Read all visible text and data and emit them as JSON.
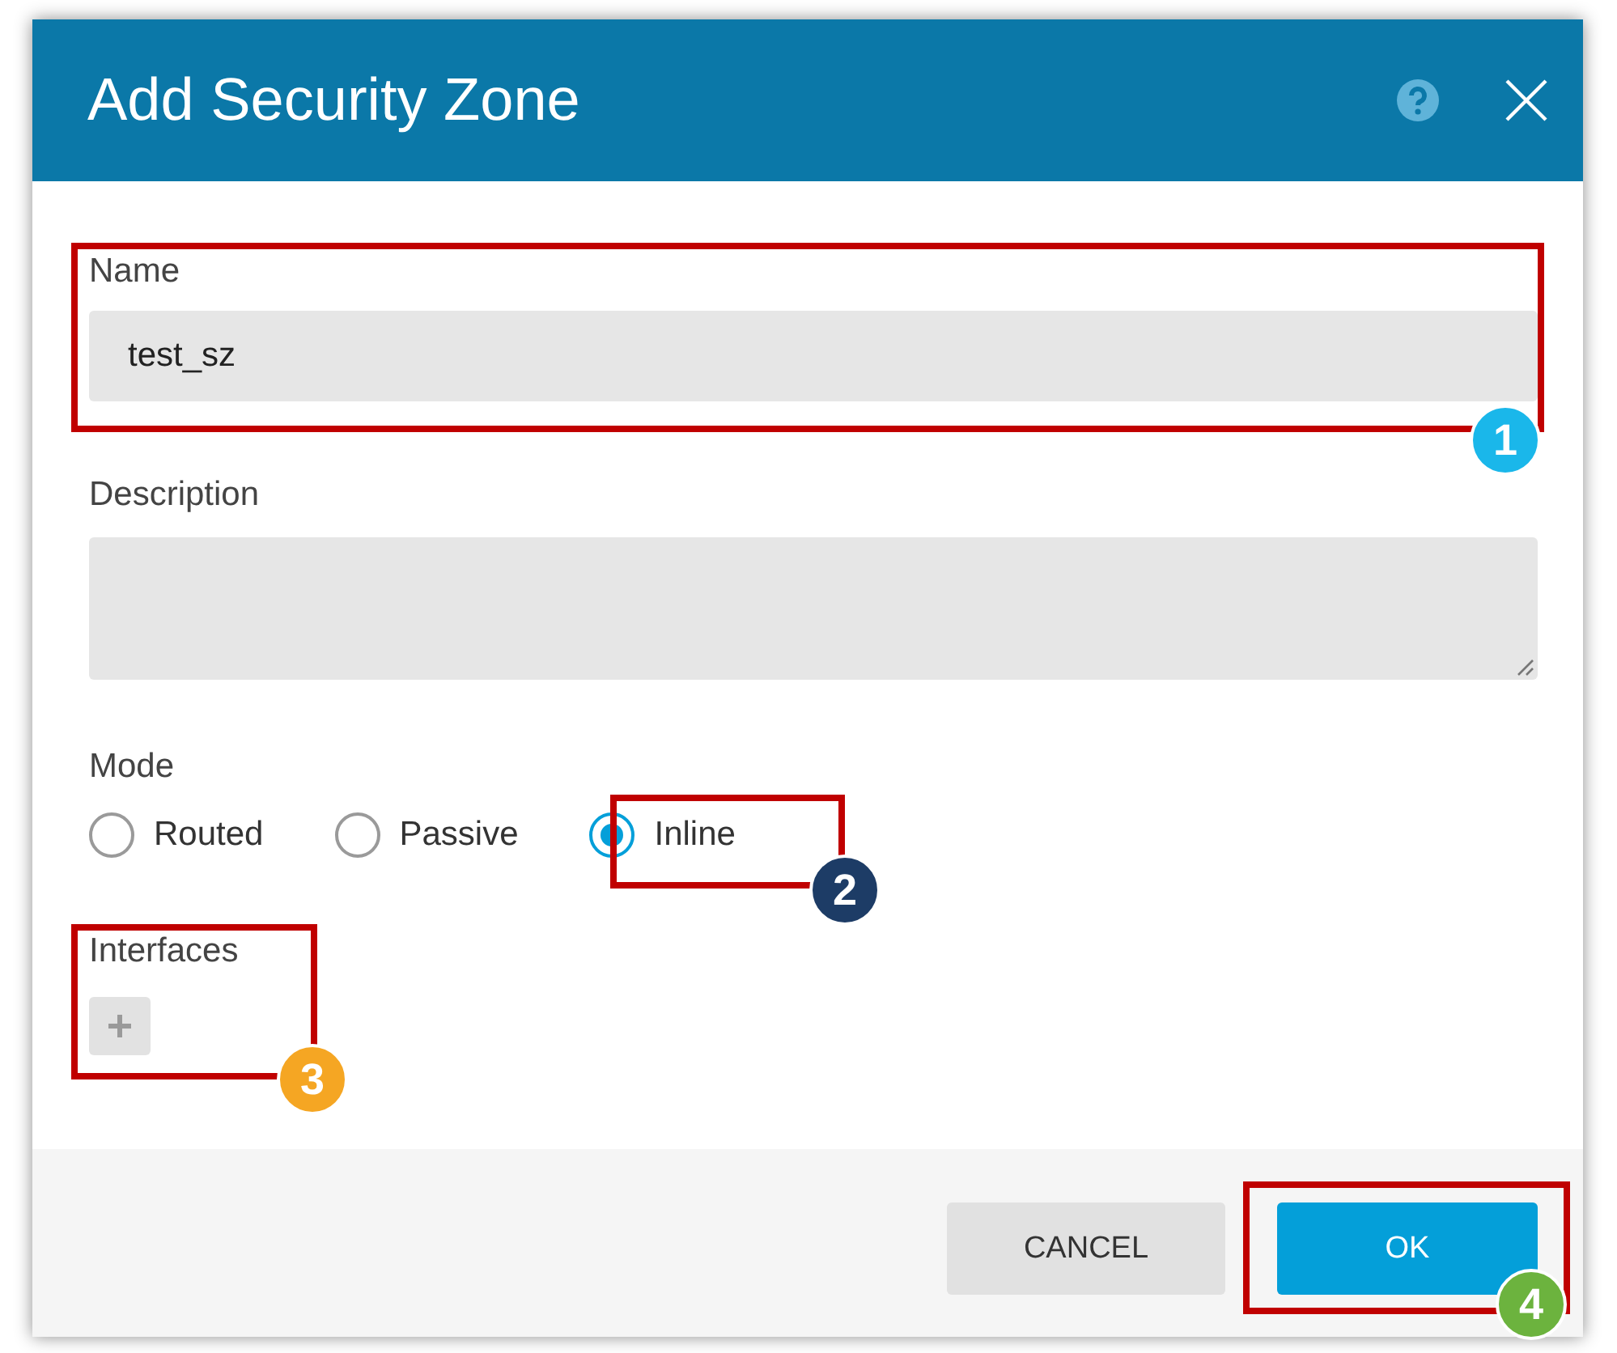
{
  "dialog": {
    "title": "Add Security Zone"
  },
  "name": {
    "label": "Name",
    "value": "test_sz"
  },
  "description": {
    "label": "Description"
  },
  "mode": {
    "label": "Mode",
    "options": [
      {
        "label": "Routed",
        "selected": false
      },
      {
        "label": "Passive",
        "selected": false
      },
      {
        "label": "Inline",
        "selected": true
      }
    ]
  },
  "interfaces": {
    "label": "Interfaces"
  },
  "buttons": [
    {
      "label": "CANCEL",
      "kind": "secondary"
    },
    {
      "label": "OK",
      "kind": "primary"
    }
  ],
  "annotations": [
    {
      "number": "1",
      "color": "#1ab7ea"
    },
    {
      "number": "2",
      "color": "#1d3c66"
    },
    {
      "number": "3",
      "color": "#f5a623"
    },
    {
      "number": "4",
      "color": "#6cb33e"
    }
  ]
}
